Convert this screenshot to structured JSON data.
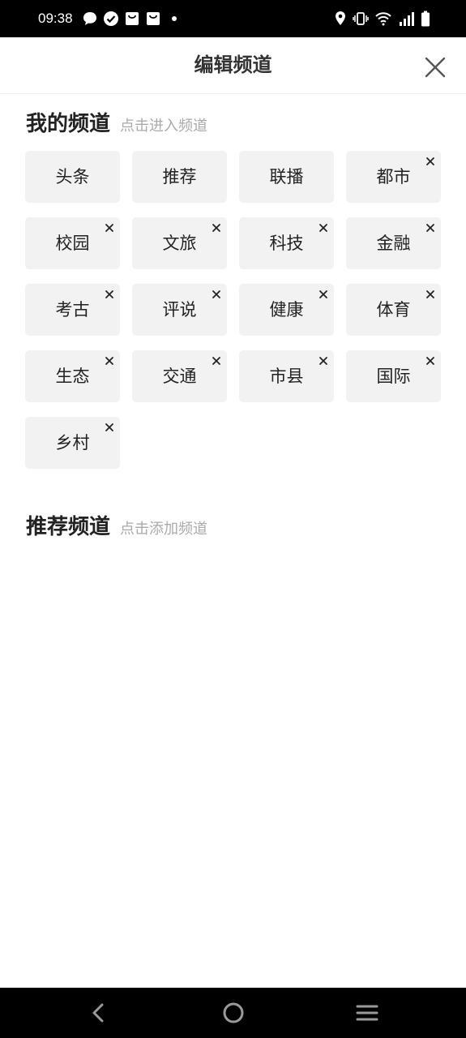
{
  "status_bar": {
    "time": "09:38",
    "left_icons": [
      "messages-icon",
      "check-circle-icon",
      "shopping-bag-icon",
      "shopping-bag-icon",
      "dot-icon"
    ],
    "right_icons": [
      "location-icon",
      "vibrate-icon",
      "wifi-icon",
      "signal-icon",
      "battery-icon"
    ]
  },
  "header": {
    "title": "编辑频道",
    "close_icon": "close-icon"
  },
  "my_channels": {
    "title": "我的频道",
    "hint": "点击进入频道",
    "items": [
      {
        "label": "头条",
        "removable": false
      },
      {
        "label": "推荐",
        "removable": false
      },
      {
        "label": "联播",
        "removable": false
      },
      {
        "label": "都市",
        "removable": true
      },
      {
        "label": "校园",
        "removable": true
      },
      {
        "label": "文旅",
        "removable": true
      },
      {
        "label": "科技",
        "removable": true
      },
      {
        "label": "金融",
        "removable": true
      },
      {
        "label": "考古",
        "removable": true
      },
      {
        "label": "评说",
        "removable": true
      },
      {
        "label": "健康",
        "removable": true
      },
      {
        "label": "体育",
        "removable": true
      },
      {
        "label": "生态",
        "removable": true
      },
      {
        "label": "交通",
        "removable": true
      },
      {
        "label": "市县",
        "removable": true
      },
      {
        "label": "国际",
        "removable": true
      },
      {
        "label": "乡村",
        "removable": true
      }
    ]
  },
  "recommended_channels": {
    "title": "推荐频道",
    "hint": "点击添加频道",
    "items": []
  },
  "nav_bar": {
    "icons": [
      "back-icon",
      "home-icon",
      "menu-icon"
    ]
  },
  "colors": {
    "tile_bg": "#f2f2f2",
    "hint_text": "#aaaaaa",
    "title_text": "#222222"
  }
}
